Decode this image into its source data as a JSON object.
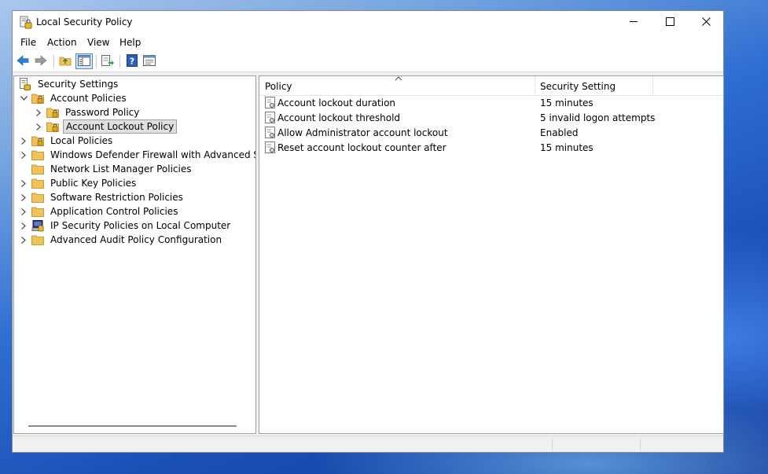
{
  "window": {
    "title": "Local Security Policy",
    "minimize_icon": "minimize-icon",
    "maximize_icon": "maximize-icon",
    "close_icon": "close-icon"
  },
  "menu": [
    "File",
    "Action",
    "View",
    "Help"
  ],
  "toolbar": {
    "buttons": [
      "back-arrow-icon",
      "forward-arrow-icon",
      "up-folder-icon",
      "show-hide-tree-icon",
      "export-list-icon",
      "help-icon",
      "properties-icon"
    ]
  },
  "tree": {
    "root": "Security Settings",
    "items": [
      {
        "label": "Account Policies",
        "expanded": true
      },
      {
        "label": "Password Policy"
      },
      {
        "label": "Account Lockout Policy",
        "selected": true
      },
      {
        "label": "Local Policies"
      },
      {
        "label": "Windows Defender Firewall with Advanced Securit"
      },
      {
        "label": "Network List Manager Policies"
      },
      {
        "label": "Public Key Policies"
      },
      {
        "label": "Software Restriction Policies"
      },
      {
        "label": "Application Control Policies"
      },
      {
        "label": "IP Security Policies on Local Computer"
      },
      {
        "label": "Advanced Audit Policy Configuration"
      }
    ]
  },
  "list": {
    "columns": [
      "Policy",
      "Security Setting"
    ],
    "rows": [
      {
        "policy": "Account lockout duration",
        "setting": "15 minutes"
      },
      {
        "policy": "Account lockout threshold",
        "setting": "5 invalid logon attempts"
      },
      {
        "policy": "Allow Administrator account lockout",
        "setting": "Enabled"
      },
      {
        "policy": "Reset account lockout counter after",
        "setting": "15 minutes"
      }
    ]
  },
  "colors": {
    "window_bg": "#f0f0f0",
    "pane_bg": "#ffffff",
    "selection": "#e0e0e0",
    "folder": "#f2c25a",
    "toolbar_blue": "#2a7fd6"
  }
}
